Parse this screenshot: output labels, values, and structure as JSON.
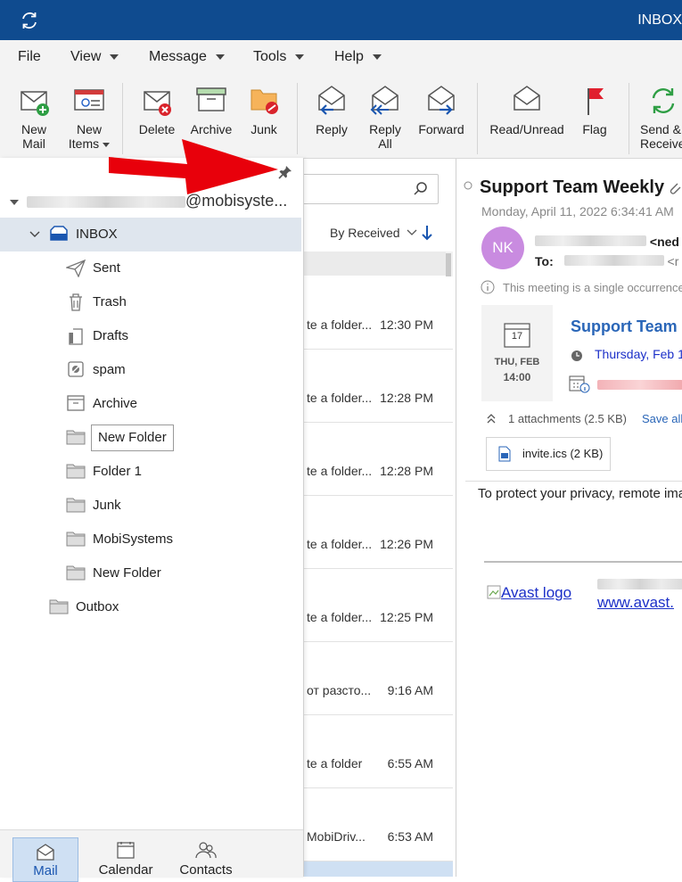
{
  "app": {
    "window_title": "INBOX"
  },
  "menu": [
    {
      "label": "File",
      "caret": false
    },
    {
      "label": "View",
      "caret": true
    },
    {
      "label": "Message",
      "caret": true
    },
    {
      "label": "Tools",
      "caret": true
    },
    {
      "label": "Help",
      "caret": true
    }
  ],
  "ribbon": {
    "new_mail": [
      "New",
      "Mail"
    ],
    "new_items": [
      "New",
      "Items"
    ],
    "delete": "Delete",
    "archive": "Archive",
    "junk": "Junk",
    "reply": "Reply",
    "reply_all": [
      "Reply",
      "All"
    ],
    "forward": "Forward",
    "read_unread": "Read/Unread",
    "flag": "Flag",
    "send_receive": [
      "Send &",
      "Receive"
    ]
  },
  "list": {
    "sort_label": "By Received",
    "rows": [
      {
        "snippet": "te a folder...",
        "time": "12:30 PM"
      },
      {
        "snippet": "te a folder...",
        "time": "12:28 PM"
      },
      {
        "snippet": "te a folder...",
        "time": "12:28 PM"
      },
      {
        "snippet": "te a folder...",
        "time": "12:26 PM"
      },
      {
        "snippet": "te a folder...",
        "time": "12:25 PM"
      },
      {
        "snippet": "от разсто...",
        "time": "9:16 AM"
      },
      {
        "snippet": "te a folder",
        "time": "6:55 AM"
      },
      {
        "snippet": "MobiDriv...",
        "time": "6:53 AM"
      }
    ]
  },
  "panel": {
    "account": "@mobisyste...",
    "folders": [
      {
        "label": "INBOX",
        "icon": "inbox-icon"
      },
      {
        "label": "Sent",
        "icon": "send-icon"
      },
      {
        "label": "Trash",
        "icon": "trash-icon"
      },
      {
        "label": "Drafts",
        "icon": "drafts-icon"
      },
      {
        "label": "spam",
        "icon": "spam-icon"
      },
      {
        "label": "Archive",
        "icon": "archive-icon"
      },
      {
        "label": "New Folder",
        "icon": "folder-icon"
      },
      {
        "label": "Folder 1",
        "icon": "folder-icon"
      },
      {
        "label": "Junk",
        "icon": "folder-icon"
      },
      {
        "label": "MobiSystems",
        "icon": "folder-icon"
      },
      {
        "label": "New Folder",
        "icon": "folder-icon"
      },
      {
        "label": "Outbox",
        "icon": "folder-icon"
      }
    ]
  },
  "nav": {
    "mail": "Mail",
    "calendar": "Calendar",
    "contacts": "Contacts"
  },
  "reading": {
    "subject": "Support Team Weekly",
    "date": "Monday, April 11, 2022 6:34:41 AM",
    "avatar": "NK",
    "from_suffix": "<ned",
    "to_label": "To:",
    "to_suffix": "<r",
    "meeting_note": "This meeting is a single occurrence",
    "cal_day": "17",
    "cal_date": "THU, FEB",
    "cal_time": "14:00",
    "meeting_title": "Support Team",
    "meeting_when": "Thursday, Feb 1",
    "attachments": "1 attachments (2.5 KB)",
    "save_all": "Save all",
    "attachment_file": "invite.ics (2 KB)",
    "privacy": "To protect your privacy, remote ima",
    "avast_logo": "Avast logo",
    "avast_link": "www.avast."
  },
  "colors": {
    "titlebar": "#0f4b8f",
    "accent": "#1a56b0",
    "avatar": "#c98be0",
    "arrow": "#e8000b"
  }
}
